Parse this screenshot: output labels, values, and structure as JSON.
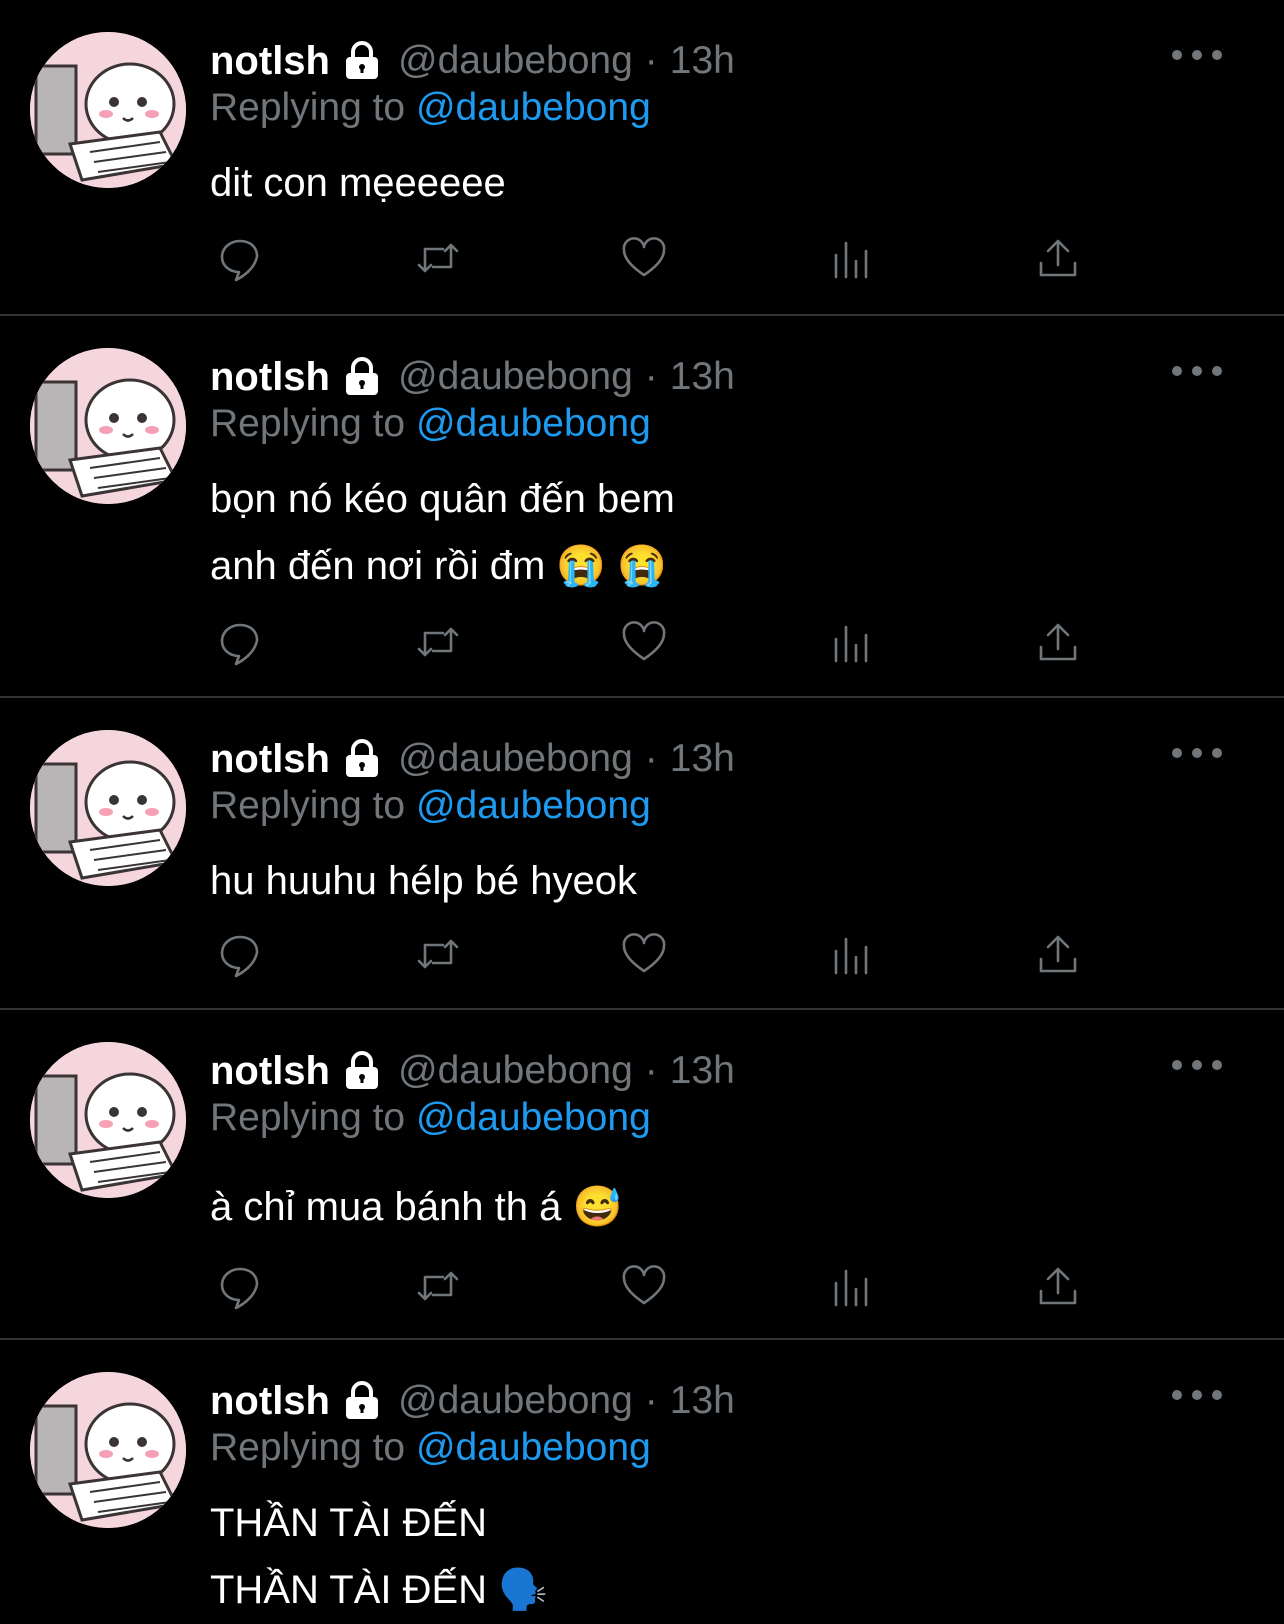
{
  "colors": {
    "background": "#000000",
    "text_primary": "#ffffff",
    "text_secondary": "#71767b",
    "link": "#1d9bf0",
    "divider": "#2f3336"
  },
  "icons": {
    "verified_lock": "lock-icon",
    "more": "more-horizontal-icon",
    "reply": "reply-icon",
    "retweet": "retweet-icon",
    "like": "heart-icon",
    "views": "views-bar-chart-icon",
    "share": "share-icon"
  },
  "tweets": [
    {
      "name": "notlsh",
      "handle": "@daubebong",
      "dot": "·",
      "time": "13h",
      "replying_prefix": "Replying to ",
      "replying_to": "@daubebong",
      "lines": [
        "dit con mẹeeeee"
      ]
    },
    {
      "name": "notlsh",
      "handle": "@daubebong",
      "dot": "·",
      "time": "13h",
      "replying_prefix": "Replying to ",
      "replying_to": "@daubebong",
      "lines": [
        "bọn nó kéo quân đến bem",
        "anh đến nơi rồi đm 😭 😭"
      ]
    },
    {
      "name": "notlsh",
      "handle": "@daubebong",
      "dot": "·",
      "time": "13h",
      "replying_prefix": "Replying to ",
      "replying_to": "@daubebong",
      "lines": [
        "hu huuhu hélp bé hyeok"
      ]
    },
    {
      "name": "notlsh",
      "handle": "@daubebong",
      "dot": "·",
      "time": "13h",
      "replying_prefix": "Replying to ",
      "replying_to": "@daubebong",
      "lines": [
        "à chỉ mua bánh th á 😅"
      ]
    },
    {
      "name": "notlsh",
      "handle": "@daubebong",
      "dot": "·",
      "time": "13h",
      "replying_prefix": "Replying to ",
      "replying_to": "@daubebong",
      "lines": [
        "THẦN TÀI ĐẾN",
        "THẦN TÀI ĐẾN 🗣️"
      ]
    }
  ]
}
